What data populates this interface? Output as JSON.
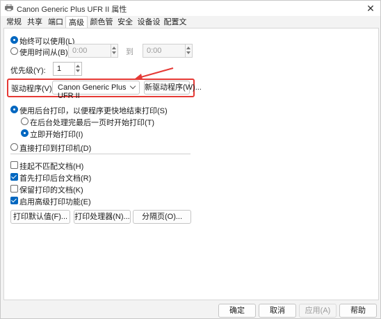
{
  "window": {
    "title": "Canon Generic Plus UFR II 属性",
    "close_glyph": "✕"
  },
  "tabs": [
    {
      "label": "常规"
    },
    {
      "label": "共享"
    },
    {
      "label": "端口"
    },
    {
      "label": "高级"
    },
    {
      "label": "颜色管理"
    },
    {
      "label": "安全"
    },
    {
      "label": "设备设置"
    },
    {
      "label": "配置文件"
    }
  ],
  "active_tab": "高级",
  "availability": {
    "always_label": "始终可以使用(L)",
    "from_label": "使用时间从(B)",
    "from_time": "0:00",
    "to_label": "到",
    "to_time": "0:00"
  },
  "priority": {
    "label": "优先级(Y):",
    "value": "1"
  },
  "driver": {
    "label": "驱动程序(V):",
    "selected": "Canon Generic Plus UFR II",
    "new_driver_button": "新驱动程序(W)..."
  },
  "spooling": {
    "spool_label": "使用后台打印，以便程序更快地结束打印(S)",
    "after_last_page_label": "在后台处理完最后一页时开始打印(T)",
    "immediately_label": "立即开始打印(I)",
    "direct_label": "直接打印到打印机(D)"
  },
  "options": [
    {
      "label": "挂起不匹配文档(H)",
      "checked": false
    },
    {
      "label": "首先打印后台文档(R)",
      "checked": true
    },
    {
      "label": "保留打印的文档(K)",
      "checked": false
    },
    {
      "label": "启用高级打印功能(E)",
      "checked": true
    }
  ],
  "buttons": {
    "defaults": "打印默认值(F)...",
    "processor": "打印处理器(N)...",
    "separator": "分隔页(O)..."
  },
  "footer": {
    "ok": "确定",
    "cancel": "取消",
    "apply": "应用(A)",
    "help": "帮助"
  },
  "colors": {
    "accent": "#0067c0",
    "highlight": "#e53935"
  }
}
